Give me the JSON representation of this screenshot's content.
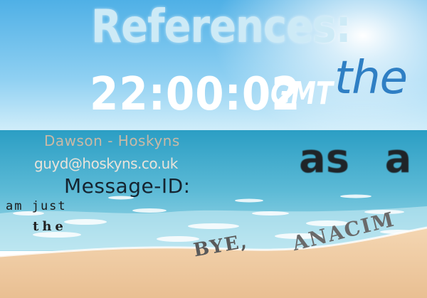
{
  "texts": {
    "references": "References:",
    "time": "22:00:02",
    "gmt": "GMT",
    "the_large": "the",
    "name": "Dawson - Hoskyns",
    "email": "guyd@hoskyns.co.uk",
    "message_id": "Message-ID:",
    "as_a": "as a",
    "am_just": "am just",
    "the_small": "the",
    "bye": "BYE,",
    "anacim": "ANACIM"
  },
  "colors": {
    "sky_top": "#5bb6ea",
    "sky_bottom": "#c7e9f8",
    "sea": "#3fa6c6",
    "sand": "#f2cfa8"
  }
}
